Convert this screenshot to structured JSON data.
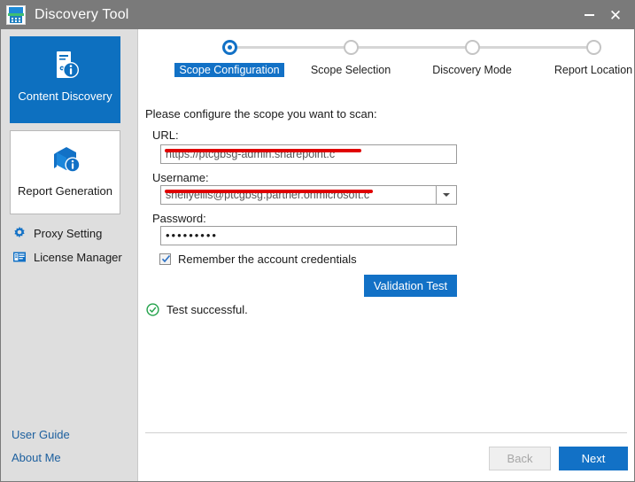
{
  "window": {
    "title": "Discovery Tool",
    "app_icon": "server-app-icon",
    "controls": {
      "minimize": "minimize-icon",
      "close": "close-icon"
    }
  },
  "sidebar": {
    "tiles": [
      {
        "label": "Content Discovery",
        "icon": "server-info-icon",
        "active": true
      },
      {
        "label": "Report Generation",
        "icon": "box-info-icon",
        "active": false
      }
    ],
    "links": [
      {
        "label": "Proxy Setting",
        "icon": "gear-icon"
      },
      {
        "label": "License Manager",
        "icon": "license-card-icon"
      }
    ],
    "footer_links": [
      {
        "label": "User Guide"
      },
      {
        "label": "About Me"
      }
    ]
  },
  "stepper": {
    "steps": [
      {
        "label": "Scope Configuration",
        "state": "current"
      },
      {
        "label": "Scope Selection",
        "state": "pending"
      },
      {
        "label": "Discovery Mode",
        "state": "pending"
      },
      {
        "label": "Report Location",
        "state": "pending"
      }
    ]
  },
  "form": {
    "intro": "Please configure the scope you want to scan:",
    "url": {
      "label": "URL:",
      "value": "https://ptcgbsg-admin.sharepoint.c",
      "redacted": true
    },
    "username": {
      "label": "Username:",
      "value": "shellyellis@ptcgbsg.partner.onmicrosoft.c",
      "redacted": true,
      "dropdown_icon": "chevron-down-icon"
    },
    "password": {
      "label": "Password:",
      "value": "•••••••••"
    },
    "remember": {
      "label": "Remember the account credentials",
      "checked": true
    },
    "validation_button": "Validation Test",
    "status": {
      "icon": "success-check-icon",
      "text": "Test successful.",
      "color": "#22a24a"
    }
  },
  "footer": {
    "back_label": "Back",
    "next_label": "Next"
  },
  "colors": {
    "titlebar": "#7a7a7a",
    "sidebar": "#dedede",
    "accent": "#1271c6",
    "tile_active": "#0d70c0",
    "success": "#22a24a",
    "redaction": "#e00000"
  }
}
